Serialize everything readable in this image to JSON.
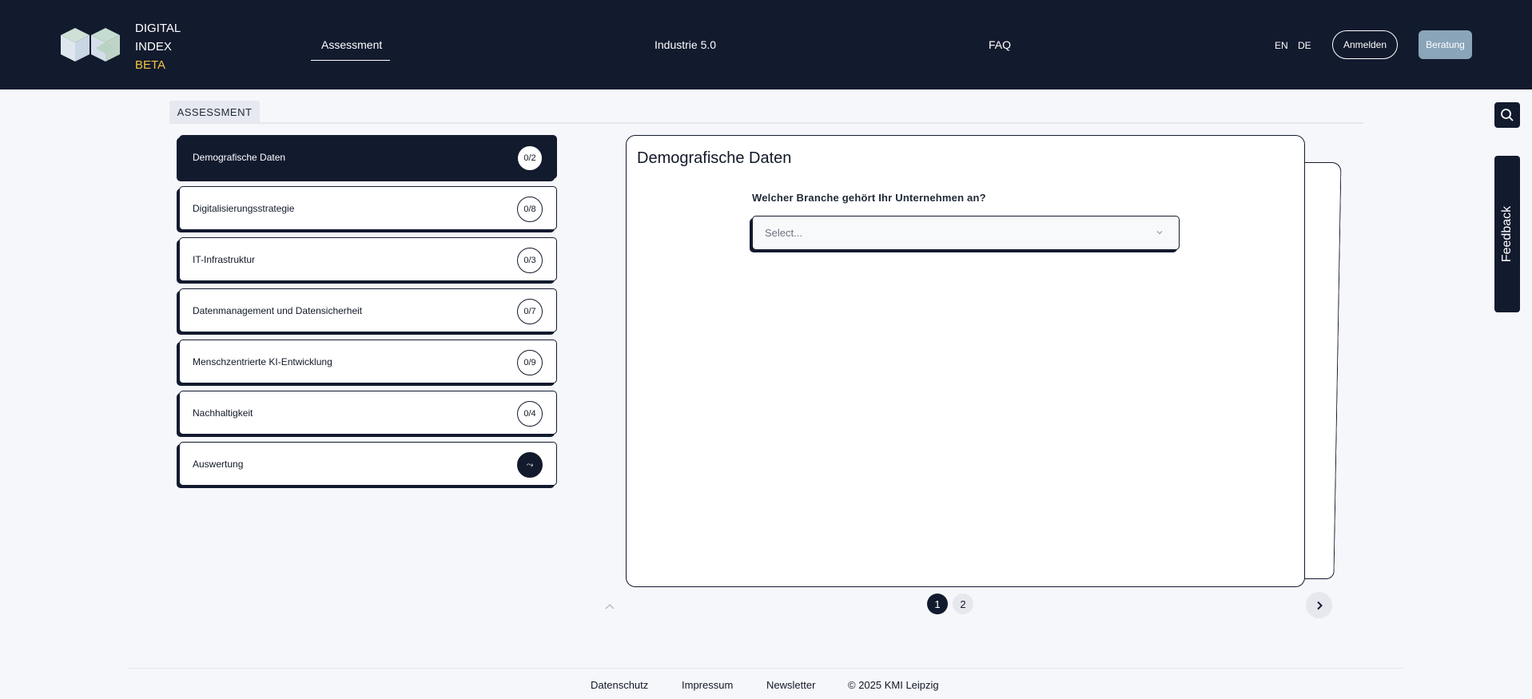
{
  "brand": {
    "line1": "DIGITAL",
    "line2": "INDEX",
    "beta": "BETA"
  },
  "nav": {
    "assessment": "Assessment",
    "industrie": "Industrie 5.0",
    "faq": "FAQ"
  },
  "lang": {
    "en": "EN",
    "de": "DE"
  },
  "buttons": {
    "login": "Anmelden",
    "beratung": "Beratung"
  },
  "section_tab": "ASSESSMENT",
  "categories": [
    {
      "label": "Demografische Daten",
      "count": "0/2"
    },
    {
      "label": "Digitalisierungsstrategie",
      "count": "0/8"
    },
    {
      "label": "IT-Infrastruktur",
      "count": "0/3"
    },
    {
      "label": "Datenmanagement und Datensicherheit",
      "count": "0/7"
    },
    {
      "label": "Menschzentrierte KI-Entwicklung",
      "count": "0/9"
    },
    {
      "label": "Nachhaltigkeit",
      "count": "0/4"
    },
    {
      "label": "Auswertung",
      "count": "⤳"
    }
  ],
  "card": {
    "title": "Demografische Daten",
    "question": "Welcher Branche gehört Ihr Unternehmen an?",
    "select_placeholder": "Select..."
  },
  "pagination": {
    "pages": [
      "1",
      "2"
    ],
    "current": "1"
  },
  "feedback": "Feedback",
  "footer": {
    "datenschutz": "Datenschutz",
    "impressum": "Impressum",
    "newsletter": "Newsletter",
    "copyright": "© 2025 KMI Leipzig"
  },
  "colors": {
    "navy": "#121a2e",
    "beta_yellow": "#f3c63f",
    "beratung_bg": "#8aa4b9"
  },
  "icons": {
    "logo": "cube-logo-icon",
    "search": "search-icon",
    "select": "chevron-down-icon",
    "prev": "chevron-up-icon",
    "next": "chevron-right-icon"
  }
}
